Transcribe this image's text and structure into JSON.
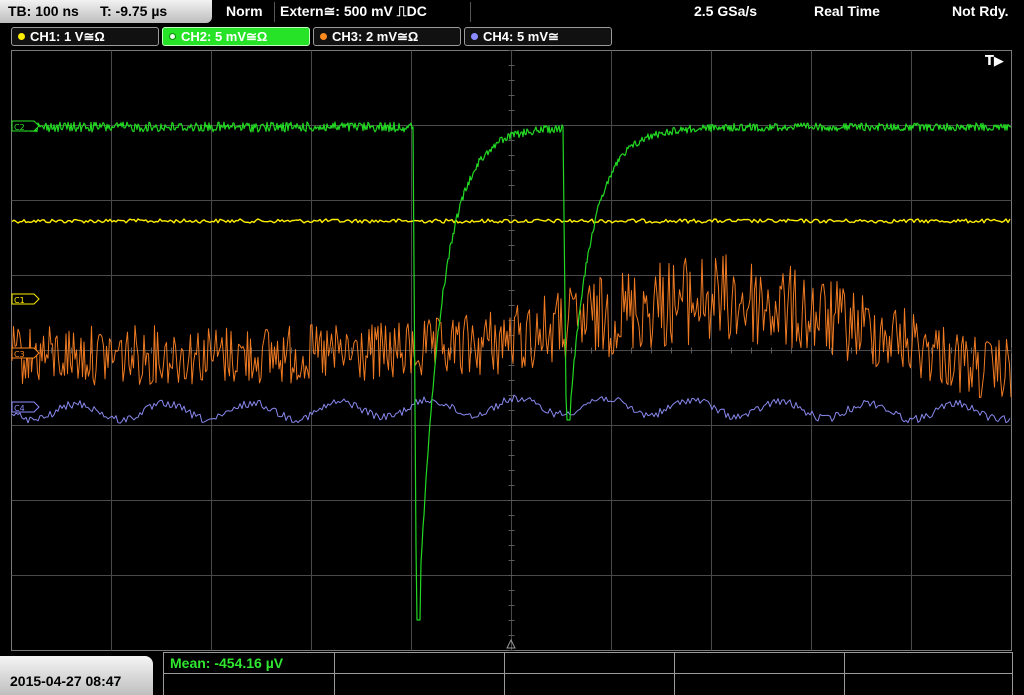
{
  "status_bar": {
    "timebase": "TB: 100 ns",
    "trigger_time": "T: -9.75 µs",
    "mode": "Norm",
    "trigger": "Extern≅: 500 mV ⎍DC",
    "sample_rate": "2.5 GSa/s",
    "acq_mode": "Real Time",
    "state": "Not Rdy."
  },
  "channels": [
    {
      "label": "CH1: 1 V≅Ω",
      "color": "#ffef00",
      "active": false
    },
    {
      "label": "CH2: 5 mV≅Ω",
      "color": "#27e327",
      "active": true
    },
    {
      "label": "CH3: 2 mV≅Ω",
      "color": "#ff8a1e",
      "active": false
    },
    {
      "label": "CH4: 5 mV≅",
      "color": "#8b8bff",
      "active": false
    }
  ],
  "markers": {
    "trigger_marker": "T▶",
    "c1": "C1",
    "c2": "C2",
    "c3": "C3",
    "c4": "C4"
  },
  "footer": {
    "datetime": "2015-04-27 08:47",
    "measurement": "Mean: -454.16 µV"
  },
  "colors": {
    "ch1": "#ffef00",
    "ch2": "#22d822",
    "ch3": "#ef7a22",
    "ch4": "#8888ee",
    "grid": "#4a4a4a"
  }
}
